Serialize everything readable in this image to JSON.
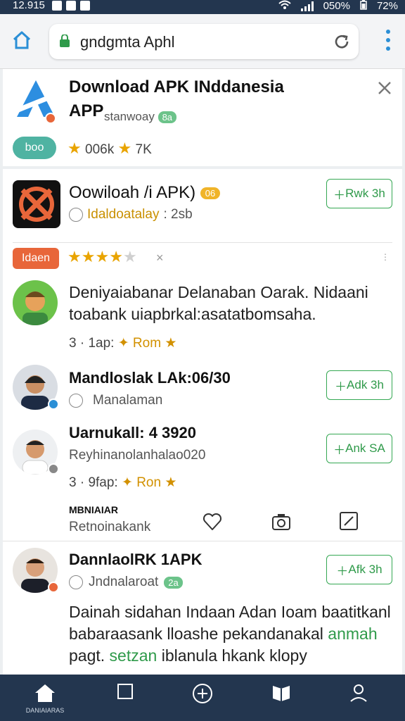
{
  "status_bar": {
    "time": "12.915",
    "battery_text": "050%",
    "battery_pct": "72%"
  },
  "browser": {
    "url": "gndgmta Aphl"
  },
  "featured_app": {
    "title": "Download APK INddanesia",
    "title_line2": "APP",
    "subtitle": "stanwoay",
    "tag": "8a",
    "action": "boo",
    "rating_text": "006k",
    "rating_count": "7K"
  },
  "app_card": {
    "title": "Oowiloah /i APK)",
    "badge": "06",
    "developer": "Idaldoatalay",
    "size": ": 2sb",
    "get_label": "Rwk 3h",
    "rating_tag": "Idaen",
    "stars": 4,
    "menu_label": "×"
  },
  "review_1": {
    "text": "Deniyaiabanar Delanaban Oarak. Nidaani toabank uiapbrkal:asatatbomsaha.",
    "time": "3 · 1ap:",
    "tag": "Rom"
  },
  "review_2": {
    "name": "Mandloslak LAk:06/30",
    "sub": "Manalaman",
    "get_label": "Adk 3h"
  },
  "review_3": {
    "name": "Uarnukall: 4 3920",
    "sub": "Reyhinanolanhalao020",
    "get_label": "Ank SA",
    "time": "3 · 9fap:",
    "tag": "Ron"
  },
  "action_row": {
    "title": "MBNIAIAR",
    "sub": "Retnoinakank"
  },
  "review_4": {
    "name": "DannlaolRK 1APK",
    "sub": "Jndnalaroat",
    "tag": "2a",
    "get_label": "Afk 3h",
    "text_1": "Dainah sidahan Indaan Adan Ioam baatitkanl",
    "text_2": "babaraasank lloashe pekandanakal",
    "text_2_green": "anmah",
    "text_3": "pagt.",
    "text_3_green": "setzan",
    "text_3_rest": "iblanula hkank klopy"
  },
  "bottom_nav": {
    "home_label": "DANIAIARAS"
  },
  "colors": {
    "accent_green": "#35a853",
    "nav_bg": "#23364f",
    "star": "#e9a400",
    "orange": "#e8663a"
  }
}
